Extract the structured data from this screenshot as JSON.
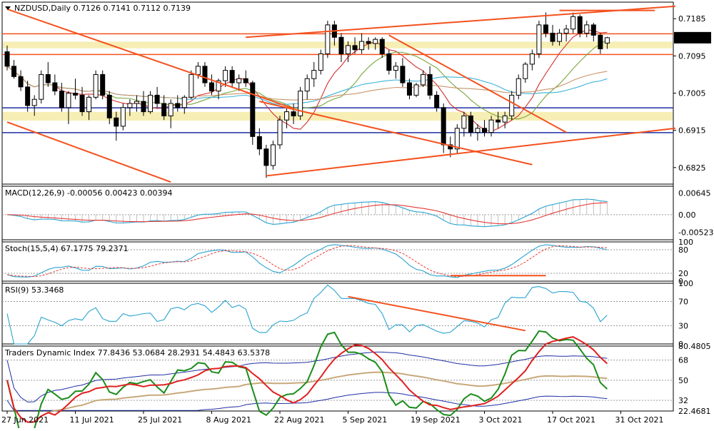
{
  "chart_data": {
    "type": "candlestick",
    "symbol_line": "NZDUSD,Daily",
    "ohlc_header": [
      "0.7126",
      "0.7141",
      "0.7112",
      "0.7139"
    ],
    "price_axis": {
      "ticks": [
        "0.7185",
        "0.7095",
        "0.7005",
        "0.6915",
        "0.6825"
      ],
      "tick_values": [
        0.7185,
        0.7095,
        0.7005,
        0.6915,
        0.6825
      ],
      "current_price": "0.7139",
      "ylim": [
        0.6785,
        0.7225
      ]
    },
    "x_axis": {
      "labels": [
        "27 Jun 2021",
        "11 Jul 2021",
        "25 Jul 2021",
        "8 Aug 2021",
        "22 Aug 2021",
        "5 Sep 2021",
        "19 Sep 2021",
        "3 Oct 2021",
        "17 Oct 2021",
        "31 Oct 2021"
      ],
      "label_bar_index": [
        0,
        10,
        20,
        30,
        40,
        50,
        60,
        70,
        80,
        90
      ]
    },
    "candles": [
      [
        0.7105,
        0.712,
        0.706,
        0.707
      ],
      [
        0.707,
        0.7085,
        0.704,
        0.7045
      ],
      [
        0.7045,
        0.706,
        0.701,
        0.702
      ],
      [
        0.702,
        0.7035,
        0.696,
        0.6975
      ],
      [
        0.6975,
        0.7,
        0.695,
        0.699
      ],
      [
        0.699,
        0.706,
        0.698,
        0.705
      ],
      [
        0.705,
        0.708,
        0.702,
        0.703
      ],
      [
        0.703,
        0.705,
        0.7,
        0.701
      ],
      [
        0.701,
        0.703,
        0.696,
        0.697
      ],
      [
        0.697,
        0.701,
        0.693,
        0.7005
      ],
      [
        0.7005,
        0.704,
        0.699,
        0.7
      ],
      [
        0.7,
        0.702,
        0.695,
        0.696
      ],
      [
        0.696,
        0.7,
        0.694,
        0.6995
      ],
      [
        0.6995,
        0.706,
        0.699,
        0.705
      ],
      [
        0.705,
        0.706,
        0.699,
        0.7
      ],
      [
        0.7,
        0.701,
        0.693,
        0.6945
      ],
      [
        0.6945,
        0.696,
        0.689,
        0.6925
      ],
      [
        0.6925,
        0.698,
        0.6915,
        0.697
      ],
      [
        0.697,
        0.699,
        0.695,
        0.698
      ],
      [
        0.698,
        0.7,
        0.696,
        0.6985
      ],
      [
        0.6985,
        0.701,
        0.695,
        0.696
      ],
      [
        0.696,
        0.701,
        0.6955,
        0.7
      ],
      [
        0.7,
        0.702,
        0.697,
        0.698
      ],
      [
        0.698,
        0.7,
        0.694,
        0.695
      ],
      [
        0.695,
        0.699,
        0.692,
        0.698
      ],
      [
        0.698,
        0.7,
        0.696,
        0.697
      ],
      [
        0.697,
        0.7,
        0.6955,
        0.6995
      ],
      [
        0.6995,
        0.706,
        0.699,
        0.705
      ],
      [
        0.705,
        0.708,
        0.704,
        0.707
      ],
      [
        0.707,
        0.708,
        0.702,
        0.703
      ],
      [
        0.703,
        0.705,
        0.7,
        0.701
      ],
      [
        0.701,
        0.704,
        0.699,
        0.7035
      ],
      [
        0.7035,
        0.707,
        0.702,
        0.706
      ],
      [
        0.706,
        0.707,
        0.702,
        0.703
      ],
      [
        0.703,
        0.705,
        0.701,
        0.704
      ],
      [
        0.704,
        0.706,
        0.702,
        0.703
      ],
      [
        0.703,
        0.7035,
        0.688,
        0.69
      ],
      [
        0.69,
        0.692,
        0.6855,
        0.687
      ],
      [
        0.687,
        0.688,
        0.68,
        0.683
      ],
      [
        0.683,
        0.689,
        0.682,
        0.688
      ],
      [
        0.688,
        0.695,
        0.687,
        0.694
      ],
      [
        0.694,
        0.697,
        0.692,
        0.696
      ],
      [
        0.696,
        0.698,
        0.693,
        0.695
      ],
      [
        0.695,
        0.702,
        0.694,
        0.701
      ],
      [
        0.701,
        0.705,
        0.699,
        0.704
      ],
      [
        0.704,
        0.708,
        0.702,
        0.706
      ],
      [
        0.706,
        0.711,
        0.705,
        0.71
      ],
      [
        0.71,
        0.718,
        0.709,
        0.717
      ],
      [
        0.717,
        0.718,
        0.712,
        0.714
      ],
      [
        0.714,
        0.715,
        0.708,
        0.71
      ],
      [
        0.71,
        0.713,
        0.708,
        0.712
      ],
      [
        0.712,
        0.714,
        0.71,
        0.711
      ],
      [
        0.711,
        0.715,
        0.71,
        0.713
      ],
      [
        0.713,
        0.714,
        0.711,
        0.7125
      ],
      [
        0.7125,
        0.714,
        0.711,
        0.7135
      ],
      [
        0.7135,
        0.714,
        0.709,
        0.71
      ],
      [
        0.71,
        0.711,
        0.705,
        0.706
      ],
      [
        0.706,
        0.708,
        0.704,
        0.707
      ],
      [
        0.707,
        0.709,
        0.702,
        0.703
      ],
      [
        0.703,
        0.704,
        0.699,
        0.7
      ],
      [
        0.7,
        0.703,
        0.6995,
        0.7025
      ],
      [
        0.7025,
        0.706,
        0.702,
        0.705
      ],
      [
        0.705,
        0.707,
        0.699,
        0.7
      ],
      [
        0.7,
        0.701,
        0.696,
        0.697
      ],
      [
        0.697,
        0.698,
        0.686,
        0.688
      ],
      [
        0.688,
        0.69,
        0.685,
        0.687
      ],
      [
        0.687,
        0.693,
        0.686,
        0.692
      ],
      [
        0.692,
        0.696,
        0.69,
        0.695
      ],
      [
        0.695,
        0.696,
        0.69,
        0.691
      ],
      [
        0.691,
        0.693,
        0.689,
        0.692
      ],
      [
        0.692,
        0.694,
        0.69,
        0.691
      ],
      [
        0.691,
        0.695,
        0.69,
        0.694
      ],
      [
        0.694,
        0.696,
        0.692,
        0.6935
      ],
      [
        0.6935,
        0.696,
        0.692,
        0.695
      ],
      [
        0.695,
        0.701,
        0.694,
        0.7
      ],
      [
        0.7,
        0.705,
        0.699,
        0.704
      ],
      [
        0.704,
        0.708,
        0.703,
        0.7075
      ],
      [
        0.7075,
        0.711,
        0.706,
        0.71
      ],
      [
        0.71,
        0.718,
        0.709,
        0.717
      ],
      [
        0.717,
        0.72,
        0.714,
        0.715
      ],
      [
        0.715,
        0.717,
        0.712,
        0.713
      ],
      [
        0.713,
        0.716,
        0.712,
        0.715
      ],
      [
        0.715,
        0.717,
        0.713,
        0.716
      ],
      [
        0.716,
        0.72,
        0.715,
        0.719
      ],
      [
        0.719,
        0.7195,
        0.714,
        0.715
      ],
      [
        0.715,
        0.718,
        0.714,
        0.717
      ],
      [
        0.717,
        0.7175,
        0.713,
        0.7145
      ],
      [
        0.7145,
        0.715,
        0.71,
        0.7112
      ],
      [
        0.7126,
        0.7141,
        0.7112,
        0.7139
      ]
    ],
    "macd": {
      "label": "MACD(12,26,9) -0.00056 0.00423 0.00394",
      "ticks": [
        "0.00645",
        "0.00",
        "-0.00523"
      ]
    },
    "stoch": {
      "label": "Stoch(15,5,4) 67.1775 79.2371",
      "ticks": [
        "100",
        "80",
        "20",
        "0"
      ]
    },
    "rsi": {
      "label": "RSI(9) 53.3468",
      "ticks": [
        "100",
        "70",
        "30",
        "0"
      ]
    },
    "tdi": {
      "label": "Traders Dynamic Index 77.8436 53.0684 28.2931 54.4843 63.5378",
      "ticks": [
        "80.4805",
        "68",
        "50",
        "32",
        "22.4681"
      ]
    },
    "colors": {
      "bull": "#ffffff",
      "bear": "#000000",
      "trendline": "#f4511e",
      "zone": "#f6eeb4",
      "ma_fast": "#d32f2f",
      "ma_mid": "#3cb4d8",
      "ma_slow": "#c8956a",
      "ma_green": "#7aa63b",
      "macd_signal": "#e53935",
      "macd_main": "#29a3d0",
      "tdi_green": "#1a8c1a",
      "tdi_red": "#e02020",
      "tdi_band": "#1f2fa3",
      "tdi_mid": "#c8a87a"
    }
  }
}
